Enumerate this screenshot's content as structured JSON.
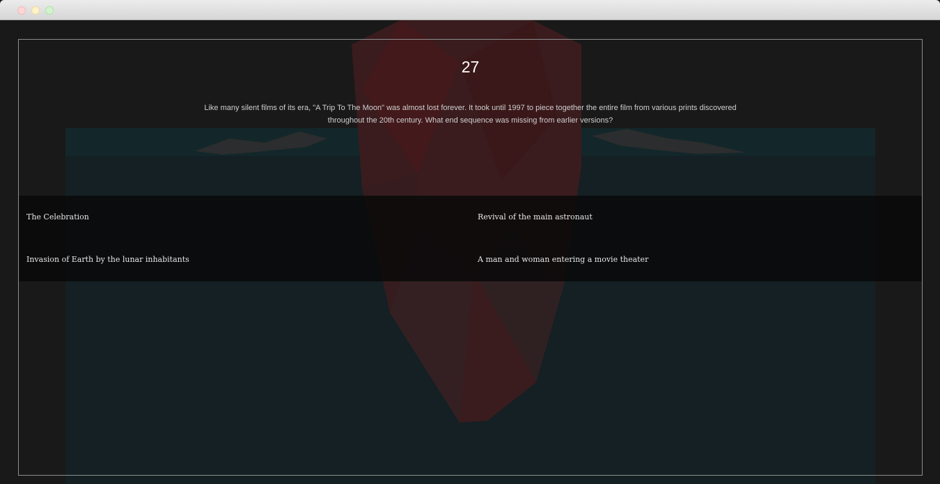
{
  "quiz": {
    "question_number": "27",
    "question_text": "Like many silent films of its era, \"A Trip To The Moon\" was almost lost forever. It took until 1997 to piece together the entire film from various prints discovered throughout the 20th century. What end sequence was missing from earlier versions?",
    "answers": [
      "The Celebration",
      "Revival of the main astronaut",
      "Invasion of Earth by the lunar inhabitants",
      "A man and woman entering a movie theater"
    ]
  },
  "colors": {
    "background": "#191919",
    "frame_border": "#8e8e8e",
    "answer_panel": "#080808",
    "text_primary": "#ffffff"
  }
}
